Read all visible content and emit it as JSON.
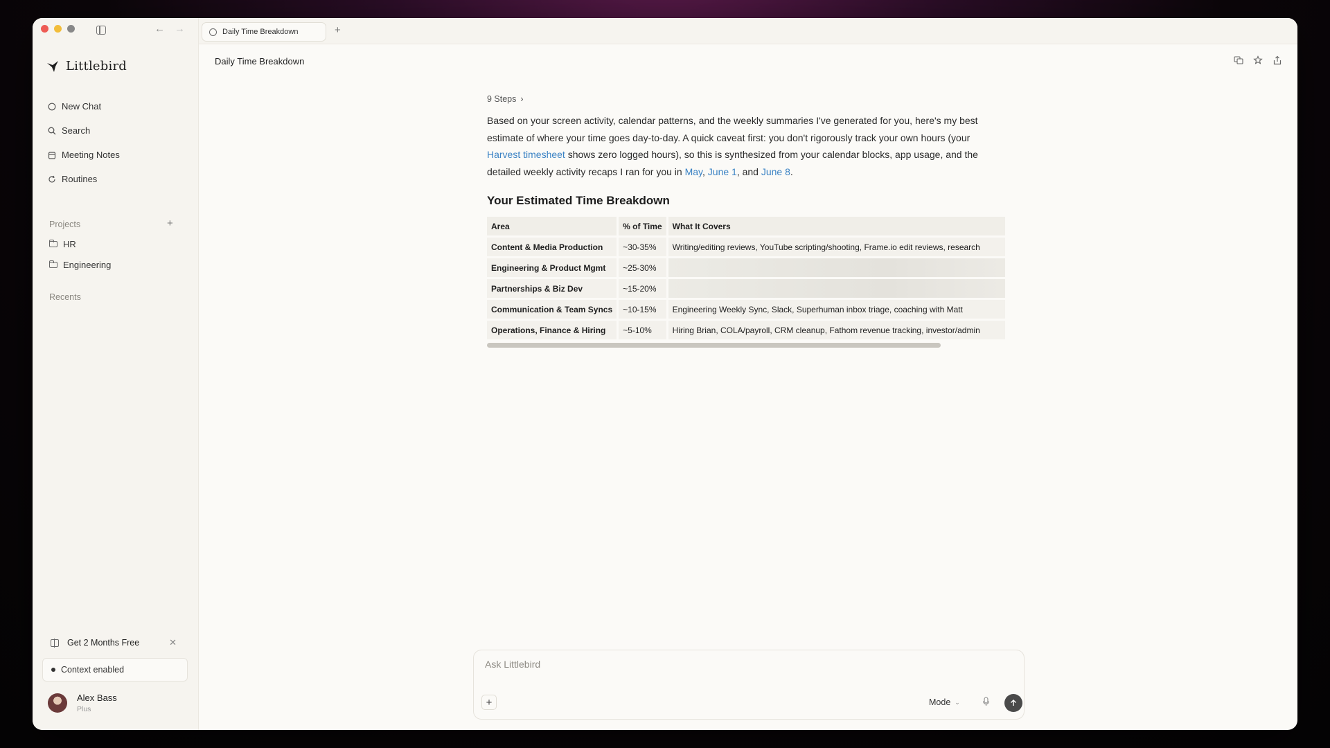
{
  "window": {
    "tab_title": "Daily Time Breakdown",
    "page_title": "Daily Time Breakdown"
  },
  "sidebar": {
    "brand": "Littlebird",
    "menu": [
      {
        "label": "New Chat",
        "icon": "chat-bubble-icon"
      },
      {
        "label": "Search",
        "icon": "search-icon"
      },
      {
        "label": "Meeting Notes",
        "icon": "calendar-icon"
      },
      {
        "label": "Routines",
        "icon": "refresh-icon"
      }
    ],
    "projects_label": "Projects",
    "projects": [
      {
        "label": "HR"
      },
      {
        "label": "Engineering"
      }
    ],
    "recents_label": "Recents",
    "promo": "Get 2 Months Free",
    "context": "Context enabled",
    "user": {
      "name": "Alex Bass",
      "plan": "Plus"
    }
  },
  "message": {
    "steps": "9 Steps",
    "para_1": "Based on your screen activity, calendar patterns, and the weekly summaries I've generated for you, here's my best estimate of where your time goes day-to-day. A quick caveat first: you don't rigorously track your own hours (your ",
    "link_harvest": "Harvest timesheet",
    "para_2": " shows zero logged hours), so this is synthesized from your calendar blocks, app usage, and the detailed weekly activity recaps I ran for you in ",
    "link_may": "May",
    "sep_1": ", ",
    "link_june1": "June 1",
    "sep_2": ", and ",
    "link_june8": "June 8",
    "end": ".",
    "heading": "Your Estimated Time Breakdown",
    "table": {
      "headers": [
        "Area",
        "% of Time",
        "What It Covers"
      ],
      "rows": [
        {
          "area": "Content & Media Production",
          "pct": "~30-35%",
          "covers": "Writing/editing reviews, YouTube scripting/shooting, Frame.io edit reviews, research"
        },
        {
          "area": "Engineering & Product Mgmt",
          "pct": "~25-30%",
          "covers": ""
        },
        {
          "area": "Partnerships & Biz Dev",
          "pct": "~15-20%",
          "covers": ""
        },
        {
          "area": "Communication & Team Syncs",
          "pct": "~10-15%",
          "covers": "Engineering Weekly Sync, Slack, Superhuman inbox triage, coaching with Matt"
        },
        {
          "area": "Operations, Finance & Hiring",
          "pct": "~5-10%",
          "covers": "Hiring Brian, COLA/payroll, CRM cleanup, Fathom revenue tracking, investor/admin"
        }
      ]
    }
  },
  "composer": {
    "placeholder": "Ask Littlebird",
    "mode_label": "Mode"
  },
  "colors": {
    "link": "#3a82c4",
    "background": "#fbfaf7",
    "sidebar": "#f6f4ef"
  }
}
